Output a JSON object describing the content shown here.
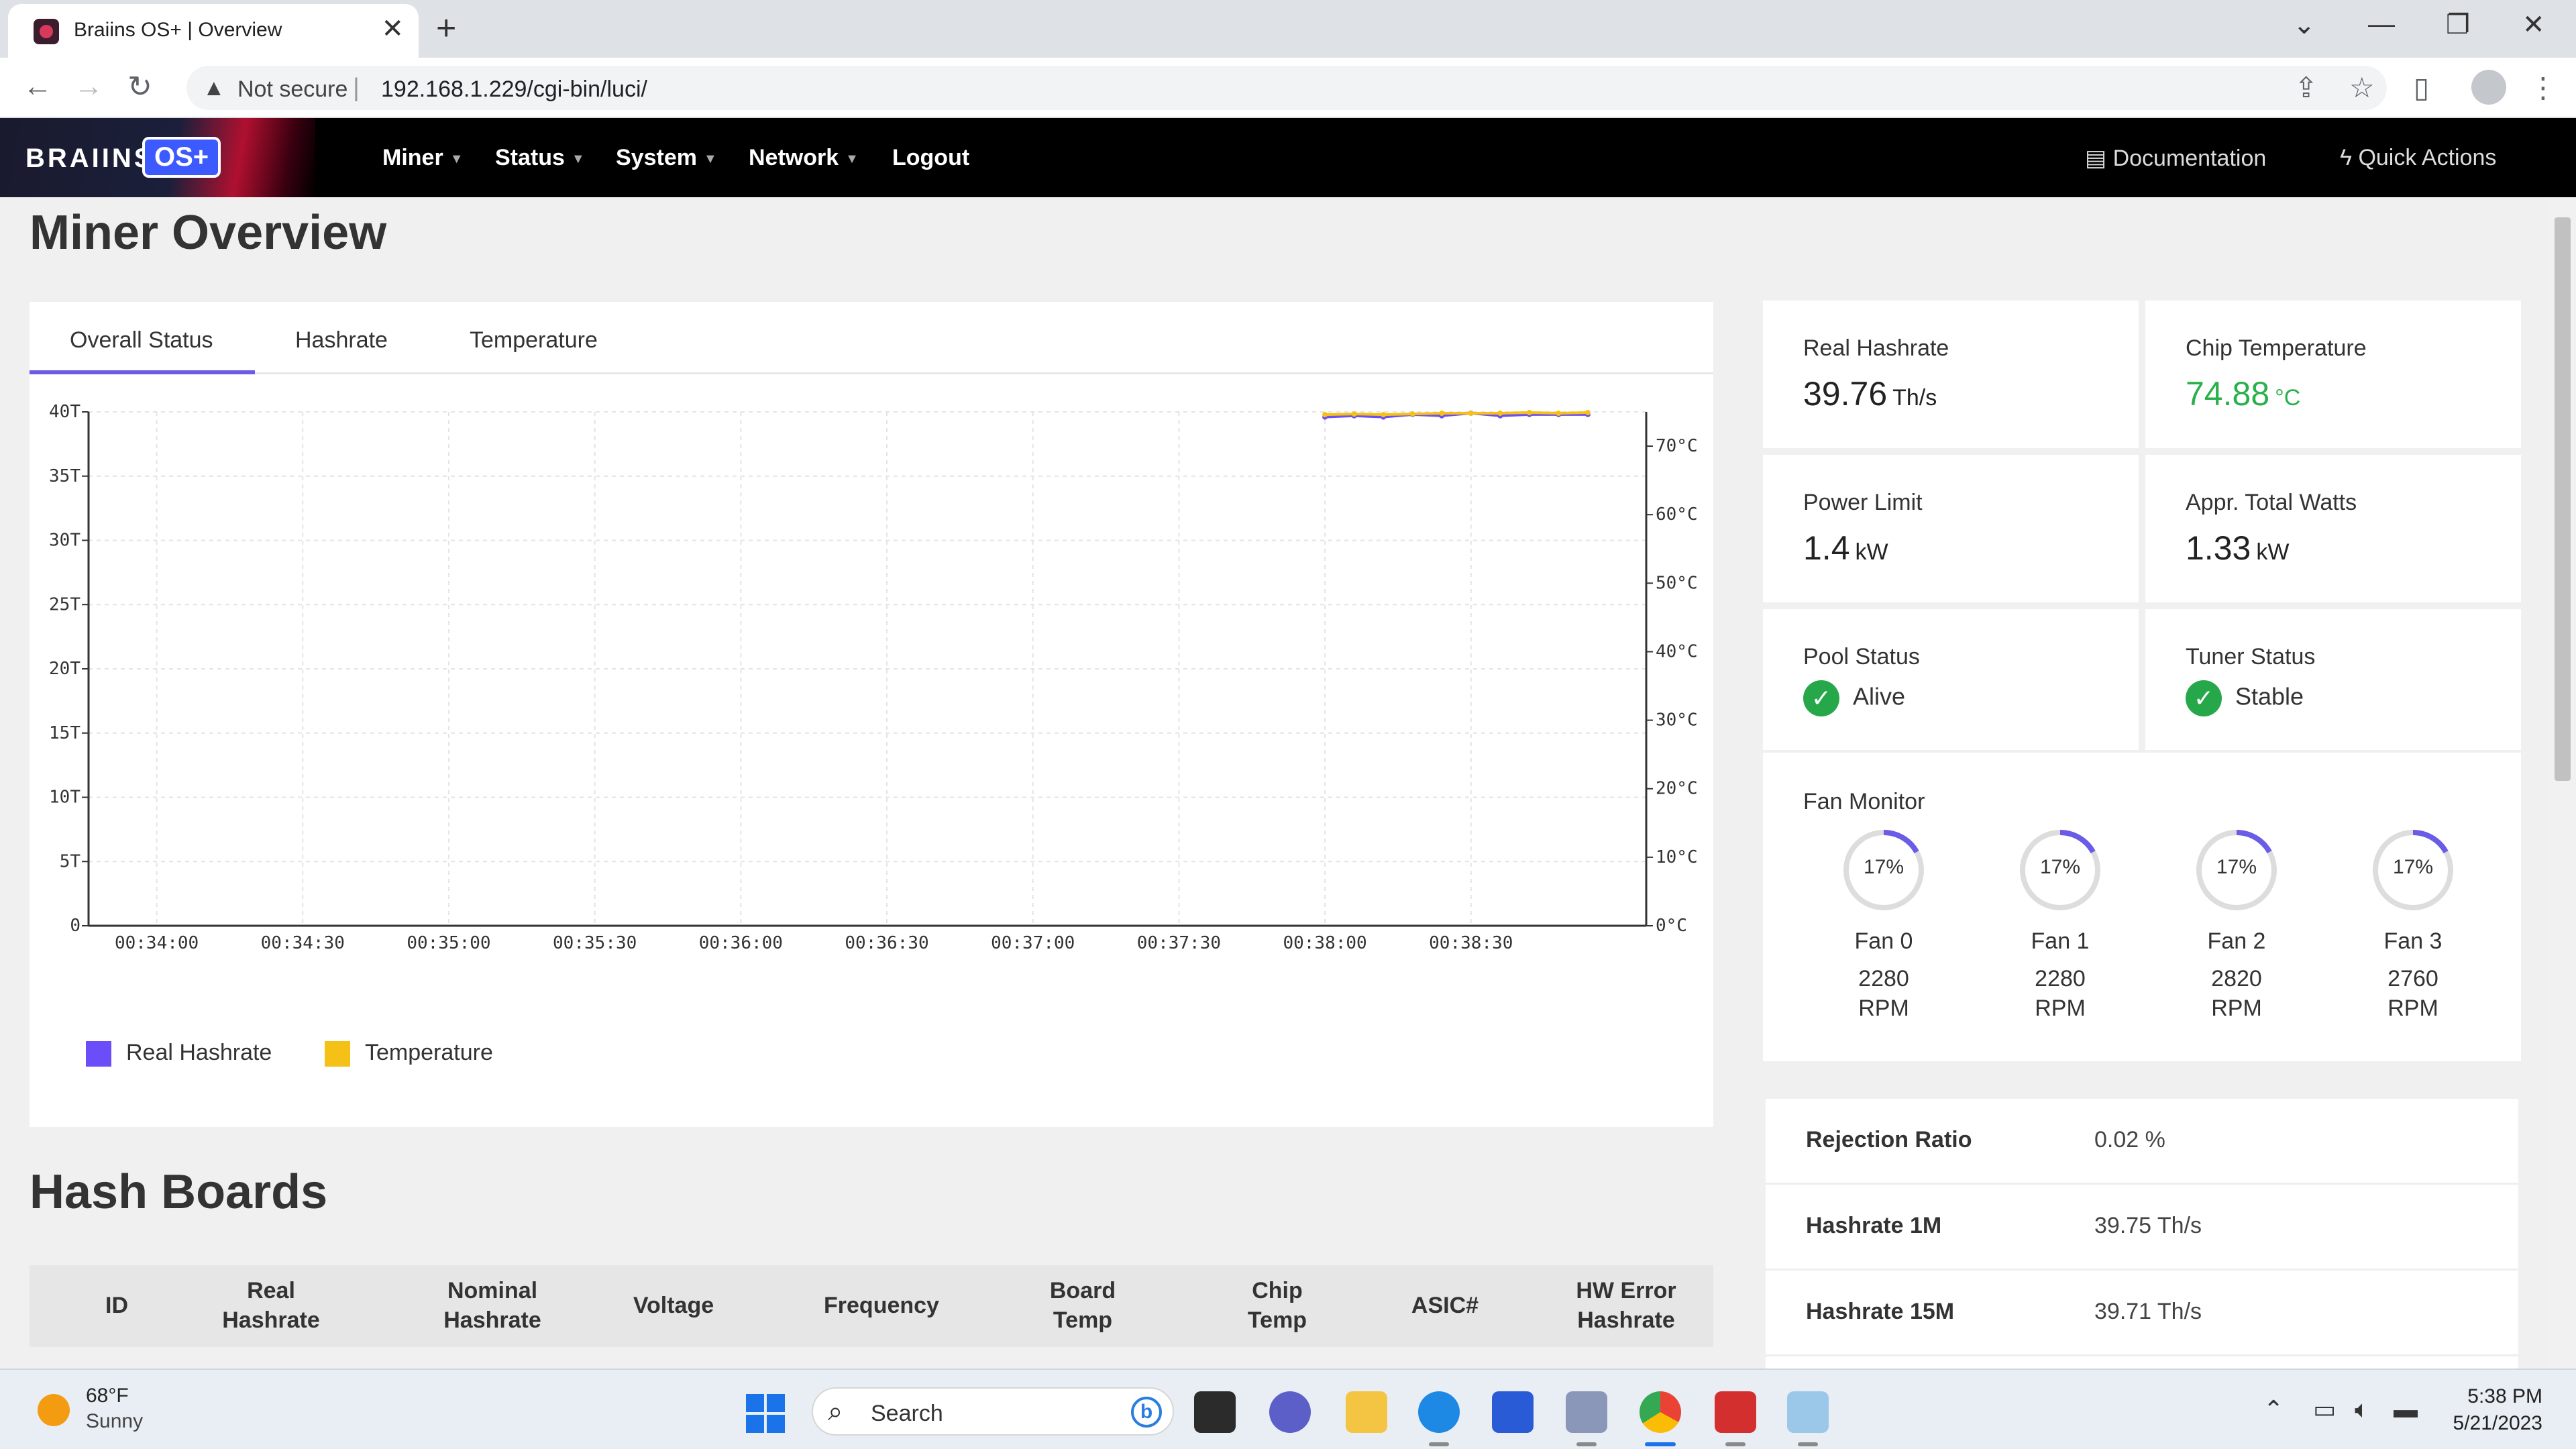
{
  "browser": {
    "tab_title": "Braiins OS+ | Overview",
    "close_glyph": "✕",
    "new_tab_glyph": "+",
    "security_label": "Not secure",
    "url": "192.168.1.229/cgi-bin/luci/"
  },
  "app": {
    "brand": "BRAIINS",
    "brand_suffix": "OS+",
    "menu": [
      {
        "label": "Miner"
      },
      {
        "label": "Status"
      },
      {
        "label": "System"
      },
      {
        "label": "Network"
      },
      {
        "label": "Logout"
      }
    ],
    "documentation": "Documentation",
    "quick_actions": "Quick Actions"
  },
  "page": {
    "title": "Miner Overview",
    "tabs": [
      "Overall Status",
      "Hashrate",
      "Temperature"
    ]
  },
  "chart_data": {
    "type": "line",
    "x_ticks": [
      "00:34:00",
      "00:34:30",
      "00:35:00",
      "00:35:30",
      "00:36:00",
      "00:36:30",
      "00:37:00",
      "00:37:30",
      "00:38:00",
      "00:38:30"
    ],
    "y_left_ticks": [
      "40T",
      "35T",
      "30T",
      "25T",
      "20T",
      "15T",
      "10T",
      "5T",
      "0"
    ],
    "y_right_ticks": [
      "70°C",
      "60°C",
      "50°C",
      "40°C",
      "30°C",
      "20°C",
      "10°C",
      "0°C"
    ],
    "ylim_left": [
      0,
      40
    ],
    "ylim_right": [
      0,
      75
    ],
    "grid": true,
    "legend_position": "bottom-left",
    "series": [
      {
        "name": "Real Hashrate",
        "color": "#6b4ef7",
        "axis": "left",
        "x": [
          "00:38:00",
          "00:38:06",
          "00:38:12",
          "00:38:18",
          "00:38:24",
          "00:38:30",
          "00:38:36",
          "00:38:42",
          "00:38:48",
          "00:38:54"
        ],
        "values": [
          39.6,
          39.7,
          39.6,
          39.8,
          39.7,
          39.9,
          39.7,
          39.8,
          39.8,
          39.8
        ]
      },
      {
        "name": "Temperature",
        "color": "#f5c116",
        "axis": "right",
        "x": [
          "00:38:00",
          "00:38:06",
          "00:38:12",
          "00:38:18",
          "00:38:24",
          "00:38:30",
          "00:38:36",
          "00:38:42",
          "00:38:48",
          "00:38:54"
        ],
        "values": [
          74.6,
          74.7,
          74.6,
          74.7,
          74.8,
          74.8,
          74.8,
          74.9,
          74.8,
          74.9
        ]
      }
    ]
  },
  "stats": {
    "real_hashrate": {
      "label": "Real Hashrate",
      "value": "39.76",
      "unit": "Th/s"
    },
    "chip_temperature": {
      "label": "Chip Temperature",
      "value": "74.88",
      "unit": "°C"
    },
    "power_limit": {
      "label": "Power Limit",
      "value": "1.4",
      "unit": "kW"
    },
    "total_watts": {
      "label": "Appr. Total Watts",
      "value": "1.33",
      "unit": "kW"
    },
    "pool_status": {
      "label": "Pool Status",
      "value": "Alive"
    },
    "tuner_status": {
      "label": "Tuner Status",
      "value": "Stable"
    }
  },
  "fans": {
    "label": "Fan Monitor",
    "items": [
      {
        "name": "Fan 0",
        "pct_label": "17%",
        "pct": 0.17,
        "rpm": "2280",
        "rpm_unit": "RPM"
      },
      {
        "name": "Fan 1",
        "pct_label": "17%",
        "pct": 0.17,
        "rpm": "2280",
        "rpm_unit": "RPM"
      },
      {
        "name": "Fan 2",
        "pct_label": "17%",
        "pct": 0.17,
        "rpm": "2820",
        "rpm_unit": "RPM"
      },
      {
        "name": "Fan 3",
        "pct_label": "17%",
        "pct": 0.17,
        "rpm": "2760",
        "rpm_unit": "RPM"
      }
    ]
  },
  "metrics": [
    {
      "key": "Rejection Ratio",
      "value": "0.02 %"
    },
    {
      "key": "Hashrate 1M",
      "value": "39.75 Th/s"
    },
    {
      "key": "Hashrate 15M",
      "value": "39.71 Th/s"
    }
  ],
  "hashboards": {
    "title": "Hash Boards",
    "columns": [
      {
        "l1": "ID",
        "l2": ""
      },
      {
        "l1": "Real",
        "l2": "Hashrate"
      },
      {
        "l1": "Nominal",
        "l2": "Hashrate"
      },
      {
        "l1": "Voltage",
        "l2": ""
      },
      {
        "l1": "Frequency",
        "l2": ""
      },
      {
        "l1": "Board",
        "l2": "Temp"
      },
      {
        "l1": "Chip",
        "l2": "Temp"
      },
      {
        "l1": "ASIC#",
        "l2": ""
      },
      {
        "l1": "HW Error",
        "l2": "Hashrate"
      }
    ]
  },
  "taskbar": {
    "weather_temp": "68°F",
    "weather_desc": "Sunny",
    "search_placeholder": "Search",
    "time": "5:38 PM",
    "date": "5/21/2023"
  },
  "colors": {
    "accent": "#6b5ce7",
    "hashrate": "#6b4ef7",
    "temperature": "#f5c116",
    "ok": "#2ab04a"
  }
}
